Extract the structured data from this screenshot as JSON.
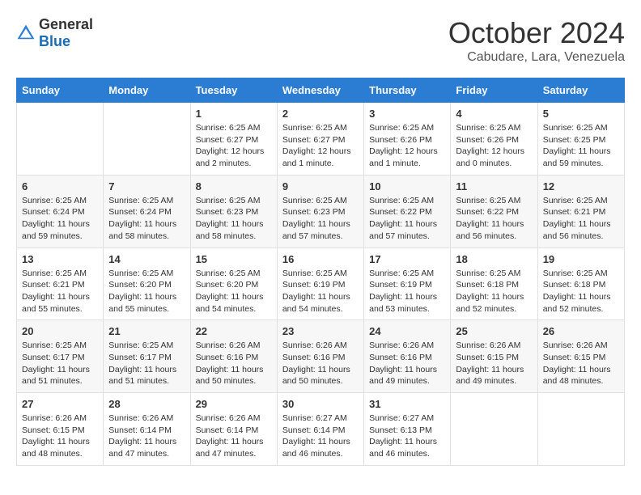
{
  "logo": {
    "general": "General",
    "blue": "Blue"
  },
  "title": "October 2024",
  "location": "Cabudare, Lara, Venezuela",
  "days_of_week": [
    "Sunday",
    "Monday",
    "Tuesday",
    "Wednesday",
    "Thursday",
    "Friday",
    "Saturday"
  ],
  "weeks": [
    [
      {
        "day": "",
        "info": ""
      },
      {
        "day": "",
        "info": ""
      },
      {
        "day": "1",
        "info": "Sunrise: 6:25 AM\nSunset: 6:27 PM\nDaylight: 12 hours and 2 minutes."
      },
      {
        "day": "2",
        "info": "Sunrise: 6:25 AM\nSunset: 6:27 PM\nDaylight: 12 hours and 1 minute."
      },
      {
        "day": "3",
        "info": "Sunrise: 6:25 AM\nSunset: 6:26 PM\nDaylight: 12 hours and 1 minute."
      },
      {
        "day": "4",
        "info": "Sunrise: 6:25 AM\nSunset: 6:26 PM\nDaylight: 12 hours and 0 minutes."
      },
      {
        "day": "5",
        "info": "Sunrise: 6:25 AM\nSunset: 6:25 PM\nDaylight: 11 hours and 59 minutes."
      }
    ],
    [
      {
        "day": "6",
        "info": "Sunrise: 6:25 AM\nSunset: 6:24 PM\nDaylight: 11 hours and 59 minutes."
      },
      {
        "day": "7",
        "info": "Sunrise: 6:25 AM\nSunset: 6:24 PM\nDaylight: 11 hours and 58 minutes."
      },
      {
        "day": "8",
        "info": "Sunrise: 6:25 AM\nSunset: 6:23 PM\nDaylight: 11 hours and 58 minutes."
      },
      {
        "day": "9",
        "info": "Sunrise: 6:25 AM\nSunset: 6:23 PM\nDaylight: 11 hours and 57 minutes."
      },
      {
        "day": "10",
        "info": "Sunrise: 6:25 AM\nSunset: 6:22 PM\nDaylight: 11 hours and 57 minutes."
      },
      {
        "day": "11",
        "info": "Sunrise: 6:25 AM\nSunset: 6:22 PM\nDaylight: 11 hours and 56 minutes."
      },
      {
        "day": "12",
        "info": "Sunrise: 6:25 AM\nSunset: 6:21 PM\nDaylight: 11 hours and 56 minutes."
      }
    ],
    [
      {
        "day": "13",
        "info": "Sunrise: 6:25 AM\nSunset: 6:21 PM\nDaylight: 11 hours and 55 minutes."
      },
      {
        "day": "14",
        "info": "Sunrise: 6:25 AM\nSunset: 6:20 PM\nDaylight: 11 hours and 55 minutes."
      },
      {
        "day": "15",
        "info": "Sunrise: 6:25 AM\nSunset: 6:20 PM\nDaylight: 11 hours and 54 minutes."
      },
      {
        "day": "16",
        "info": "Sunrise: 6:25 AM\nSunset: 6:19 PM\nDaylight: 11 hours and 54 minutes."
      },
      {
        "day": "17",
        "info": "Sunrise: 6:25 AM\nSunset: 6:19 PM\nDaylight: 11 hours and 53 minutes."
      },
      {
        "day": "18",
        "info": "Sunrise: 6:25 AM\nSunset: 6:18 PM\nDaylight: 11 hours and 52 minutes."
      },
      {
        "day": "19",
        "info": "Sunrise: 6:25 AM\nSunset: 6:18 PM\nDaylight: 11 hours and 52 minutes."
      }
    ],
    [
      {
        "day": "20",
        "info": "Sunrise: 6:25 AM\nSunset: 6:17 PM\nDaylight: 11 hours and 51 minutes."
      },
      {
        "day": "21",
        "info": "Sunrise: 6:25 AM\nSunset: 6:17 PM\nDaylight: 11 hours and 51 minutes."
      },
      {
        "day": "22",
        "info": "Sunrise: 6:26 AM\nSunset: 6:16 PM\nDaylight: 11 hours and 50 minutes."
      },
      {
        "day": "23",
        "info": "Sunrise: 6:26 AM\nSunset: 6:16 PM\nDaylight: 11 hours and 50 minutes."
      },
      {
        "day": "24",
        "info": "Sunrise: 6:26 AM\nSunset: 6:16 PM\nDaylight: 11 hours and 49 minutes."
      },
      {
        "day": "25",
        "info": "Sunrise: 6:26 AM\nSunset: 6:15 PM\nDaylight: 11 hours and 49 minutes."
      },
      {
        "day": "26",
        "info": "Sunrise: 6:26 AM\nSunset: 6:15 PM\nDaylight: 11 hours and 48 minutes."
      }
    ],
    [
      {
        "day": "27",
        "info": "Sunrise: 6:26 AM\nSunset: 6:15 PM\nDaylight: 11 hours and 48 minutes."
      },
      {
        "day": "28",
        "info": "Sunrise: 6:26 AM\nSunset: 6:14 PM\nDaylight: 11 hours and 47 minutes."
      },
      {
        "day": "29",
        "info": "Sunrise: 6:26 AM\nSunset: 6:14 PM\nDaylight: 11 hours and 47 minutes."
      },
      {
        "day": "30",
        "info": "Sunrise: 6:27 AM\nSunset: 6:14 PM\nDaylight: 11 hours and 46 minutes."
      },
      {
        "day": "31",
        "info": "Sunrise: 6:27 AM\nSunset: 6:13 PM\nDaylight: 11 hours and 46 minutes."
      },
      {
        "day": "",
        "info": ""
      },
      {
        "day": "",
        "info": ""
      }
    ]
  ]
}
